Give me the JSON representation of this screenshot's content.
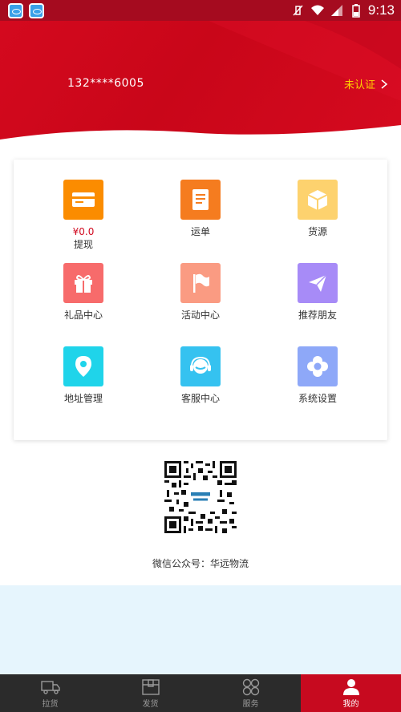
{
  "status_bar": {
    "time": "9:13"
  },
  "header": {
    "phone": "132****6005",
    "verify_label": "未认证",
    "bg_color": "#c90619"
  },
  "menu": [
    {
      "id": "withdraw",
      "amount": "¥0.0",
      "label": "提现",
      "color": "#fb8c00",
      "icon": "card-icon"
    },
    {
      "id": "waybill",
      "label": "运单",
      "color": "#f57c1f",
      "icon": "document-icon"
    },
    {
      "id": "goods",
      "label": "货源",
      "color": "#fdd26e",
      "icon": "box-icon"
    },
    {
      "id": "gifts",
      "label": "礼品中心",
      "color": "#f76b6b",
      "icon": "gift-icon"
    },
    {
      "id": "activity",
      "label": "活动中心",
      "color": "#fa9b82",
      "icon": "flag-icon"
    },
    {
      "id": "invite",
      "label": "推荐朋友",
      "color": "#a78bf7",
      "icon": "paper-plane-icon"
    },
    {
      "id": "address",
      "label": "地址管理",
      "color": "#1fd4ea",
      "icon": "location-pin-icon"
    },
    {
      "id": "service",
      "label": "客服中心",
      "color": "#35c2f0",
      "icon": "headset-icon"
    },
    {
      "id": "settings",
      "label": "系统设置",
      "color": "#8ea8f8",
      "icon": "gear-icon"
    }
  ],
  "qr": {
    "caption": "微信公众号：华远物流"
  },
  "bottom_nav": [
    {
      "label": "拉货",
      "icon": "truck-icon",
      "active": false
    },
    {
      "label": "发货",
      "icon": "package-icon",
      "active": false
    },
    {
      "label": "服务",
      "icon": "clover-icon",
      "active": false
    },
    {
      "label": "我的",
      "icon": "user-icon",
      "active": true
    }
  ]
}
